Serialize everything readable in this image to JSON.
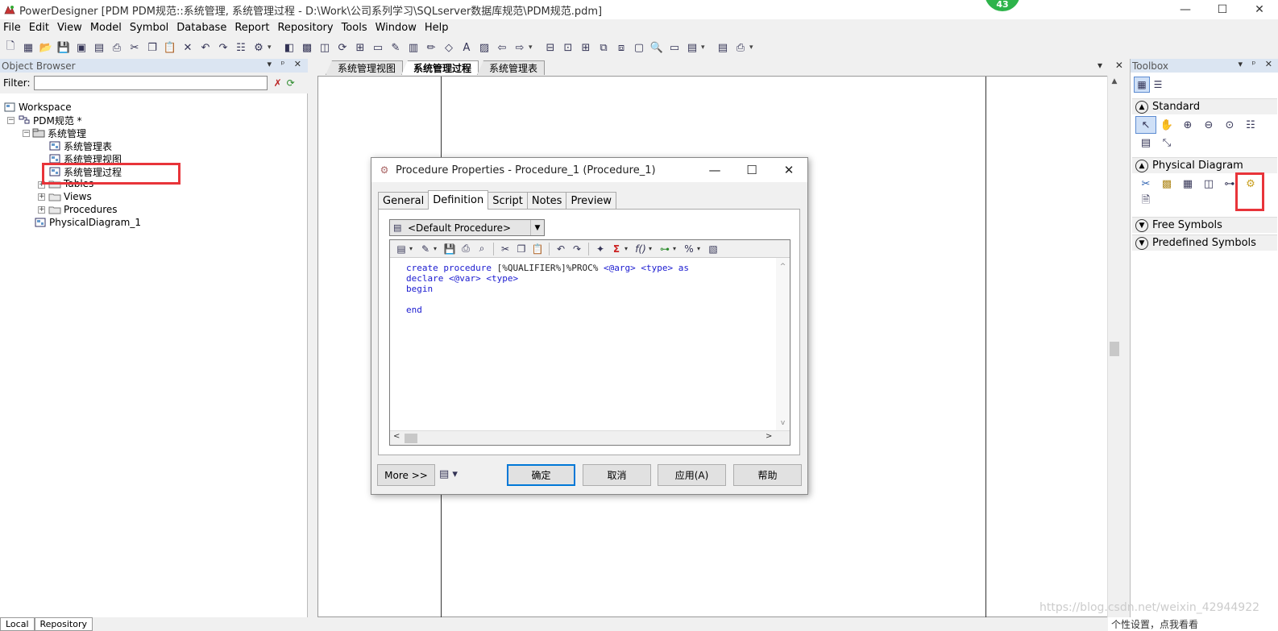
{
  "window": {
    "title": "PowerDesigner [PDM PDM规范::系统管理, 系统管理过程 - D:\\Work\\公司系列学习\\SQLserver数据库规范\\PDM规范.pdm]",
    "badge": "43",
    "minimize": "—",
    "maximize": "☐",
    "close": "✕"
  },
  "menu": [
    "File",
    "Edit",
    "View",
    "Model",
    "Symbol",
    "Database",
    "Report",
    "Repository",
    "Tools",
    "Window",
    "Help"
  ],
  "object_browser": {
    "header": "Object Browser",
    "controls": "▾ ᵖ ✕",
    "filter_label": "Filter:",
    "filter_value": "",
    "tree": [
      {
        "label": "Workspace",
        "level": 0,
        "icon": "workspace-icon"
      },
      {
        "label": "PDM规范 *",
        "level": 1,
        "icon": "model-icon"
      },
      {
        "label": "系统管理",
        "level": 2,
        "icon": "package-icon"
      },
      {
        "label": "系统管理表",
        "level": 3,
        "icon": "diagram-icon"
      },
      {
        "label": "系统管理视图",
        "level": 3,
        "icon": "diagram-icon"
      },
      {
        "label": "系统管理过程",
        "level": 3,
        "icon": "diagram-icon"
      },
      {
        "label": "Tables",
        "level": 3,
        "icon": "folder-icon"
      },
      {
        "label": "Views",
        "level": 3,
        "icon": "folder-icon"
      },
      {
        "label": "Procedures",
        "level": 3,
        "icon": "folder-icon"
      },
      {
        "label": "PhysicalDiagram_1",
        "level": 2,
        "icon": "diagram-icon"
      }
    ],
    "bottom_tabs": [
      "Local",
      "Repository"
    ]
  },
  "diagram": {
    "tabs": [
      "系统管理视图",
      "系统管理过程",
      "系统管理表"
    ],
    "active_tab": "系统管理过程",
    "controls": "▾ ✕"
  },
  "toolbox": {
    "header": "Toolbox",
    "controls": "▾ ᵖ ✕",
    "sections": [
      "Standard",
      "Physical Diagram",
      "Free Symbols",
      "Predefined Symbols"
    ]
  },
  "dialog": {
    "title": "Procedure Properties - Procedure_1 (Procedure_1)",
    "tabs": [
      "General",
      "Definition",
      "Script",
      "Notes",
      "Preview"
    ],
    "active_tab": "Definition",
    "template_selected": "<Default Procedure>",
    "code_lines": [
      "create procedure [%QUALIFIER%]%PROC% <@arg> <type> as",
      "declare <@var> <type>",
      "begin",
      "",
      "end"
    ],
    "buttons": {
      "more": "More >>",
      "ok": "确定",
      "cancel": "取消",
      "apply": "应用(A)",
      "help": "帮助"
    }
  },
  "watermark": "https://blog.csdn.net/weixin_42944922",
  "corner_text": "个性设置，点我看看",
  "colors": {
    "highlight_red": "#e8343a",
    "code_blue": "#1a1ad0",
    "panel_header": "#dbe5f2"
  }
}
